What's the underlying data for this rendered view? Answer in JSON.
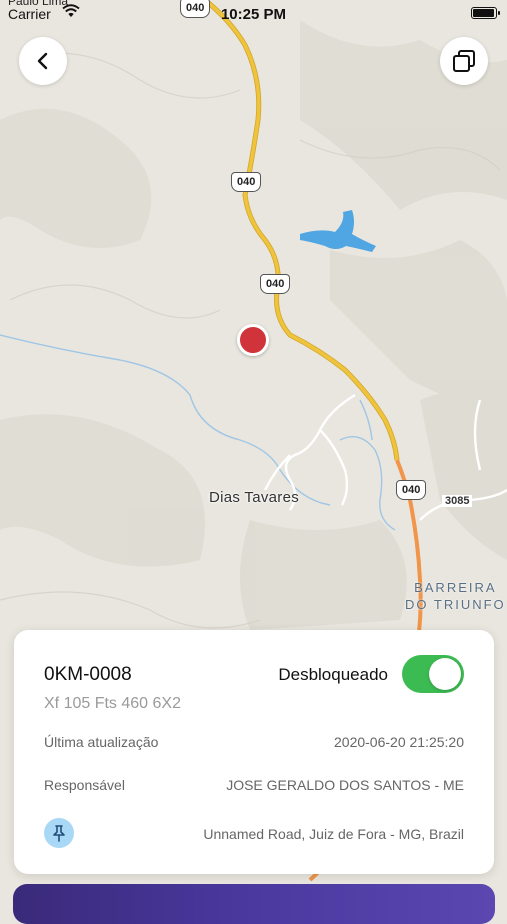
{
  "status_bar": {
    "carrier_top": "Paulo Lima",
    "carrier": "Carrier",
    "time": "10:25 PM",
    "battery_level": 0.95,
    "wifi_icon": "wifi-icon"
  },
  "map": {
    "road_labels": [
      "040",
      "040",
      "040",
      "040"
    ],
    "route_secondary": "3085",
    "towns": {
      "dias_tavares": "Dias Tavares",
      "barreira_line1": "BARREIRA",
      "barreira_line2": "DO TRIUNFO"
    },
    "colors": {
      "land": "#e9e6df",
      "highway": "#f0c33c",
      "highway_orange": "#f0954a",
      "water": "#4fa6e3",
      "marker": "#d0343a"
    }
  },
  "toolbar": {
    "back_icon": "chevron-left-icon",
    "layers_icon": "copy-layers-icon"
  },
  "vehicle_card": {
    "id": "0KM-0008",
    "model": "Xf 105 Fts 460 6X2",
    "status_label": "Desbloqueado",
    "status_on": true,
    "status_color": "#3dbb53",
    "rows": [
      {
        "label": "Última atualização",
        "value": "2020-06-20 21:25:20"
      },
      {
        "label": "Responsável",
        "value": "JOSE GERALDO DOS SANTOS - ME"
      }
    ],
    "address_icon": "pin-icon",
    "address": "Unnamed Road, Juiz de Fora - MG, Brazil"
  }
}
